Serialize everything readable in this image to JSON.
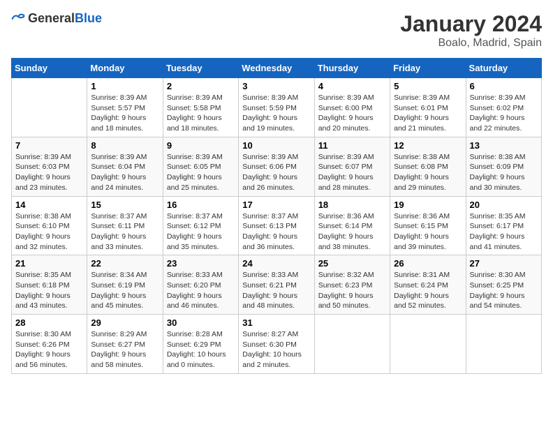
{
  "header": {
    "logo_general": "General",
    "logo_blue": "Blue",
    "month": "January 2024",
    "location": "Boalo, Madrid, Spain"
  },
  "weekdays": [
    "Sunday",
    "Monday",
    "Tuesday",
    "Wednesday",
    "Thursday",
    "Friday",
    "Saturday"
  ],
  "rows": [
    [
      {
        "day": "",
        "sunrise": "",
        "sunset": "",
        "daylight": ""
      },
      {
        "day": "1",
        "sunrise": "Sunrise: 8:39 AM",
        "sunset": "Sunset: 5:57 PM",
        "daylight": "Daylight: 9 hours and 18 minutes."
      },
      {
        "day": "2",
        "sunrise": "Sunrise: 8:39 AM",
        "sunset": "Sunset: 5:58 PM",
        "daylight": "Daylight: 9 hours and 18 minutes."
      },
      {
        "day": "3",
        "sunrise": "Sunrise: 8:39 AM",
        "sunset": "Sunset: 5:59 PM",
        "daylight": "Daylight: 9 hours and 19 minutes."
      },
      {
        "day": "4",
        "sunrise": "Sunrise: 8:39 AM",
        "sunset": "Sunset: 6:00 PM",
        "daylight": "Daylight: 9 hours and 20 minutes."
      },
      {
        "day": "5",
        "sunrise": "Sunrise: 8:39 AM",
        "sunset": "Sunset: 6:01 PM",
        "daylight": "Daylight: 9 hours and 21 minutes."
      },
      {
        "day": "6",
        "sunrise": "Sunrise: 8:39 AM",
        "sunset": "Sunset: 6:02 PM",
        "daylight": "Daylight: 9 hours and 22 minutes."
      }
    ],
    [
      {
        "day": "7",
        "sunrise": "Sunrise: 8:39 AM",
        "sunset": "Sunset: 6:03 PM",
        "daylight": "Daylight: 9 hours and 23 minutes."
      },
      {
        "day": "8",
        "sunrise": "Sunrise: 8:39 AM",
        "sunset": "Sunset: 6:04 PM",
        "daylight": "Daylight: 9 hours and 24 minutes."
      },
      {
        "day": "9",
        "sunrise": "Sunrise: 8:39 AM",
        "sunset": "Sunset: 6:05 PM",
        "daylight": "Daylight: 9 hours and 25 minutes."
      },
      {
        "day": "10",
        "sunrise": "Sunrise: 8:39 AM",
        "sunset": "Sunset: 6:06 PM",
        "daylight": "Daylight: 9 hours and 26 minutes."
      },
      {
        "day": "11",
        "sunrise": "Sunrise: 8:39 AM",
        "sunset": "Sunset: 6:07 PM",
        "daylight": "Daylight: 9 hours and 28 minutes."
      },
      {
        "day": "12",
        "sunrise": "Sunrise: 8:38 AM",
        "sunset": "Sunset: 6:08 PM",
        "daylight": "Daylight: 9 hours and 29 minutes."
      },
      {
        "day": "13",
        "sunrise": "Sunrise: 8:38 AM",
        "sunset": "Sunset: 6:09 PM",
        "daylight": "Daylight: 9 hours and 30 minutes."
      }
    ],
    [
      {
        "day": "14",
        "sunrise": "Sunrise: 8:38 AM",
        "sunset": "Sunset: 6:10 PM",
        "daylight": "Daylight: 9 hours and 32 minutes."
      },
      {
        "day": "15",
        "sunrise": "Sunrise: 8:37 AM",
        "sunset": "Sunset: 6:11 PM",
        "daylight": "Daylight: 9 hours and 33 minutes."
      },
      {
        "day": "16",
        "sunrise": "Sunrise: 8:37 AM",
        "sunset": "Sunset: 6:12 PM",
        "daylight": "Daylight: 9 hours and 35 minutes."
      },
      {
        "day": "17",
        "sunrise": "Sunrise: 8:37 AM",
        "sunset": "Sunset: 6:13 PM",
        "daylight": "Daylight: 9 hours and 36 minutes."
      },
      {
        "day": "18",
        "sunrise": "Sunrise: 8:36 AM",
        "sunset": "Sunset: 6:14 PM",
        "daylight": "Daylight: 9 hours and 38 minutes."
      },
      {
        "day": "19",
        "sunrise": "Sunrise: 8:36 AM",
        "sunset": "Sunset: 6:15 PM",
        "daylight": "Daylight: 9 hours and 39 minutes."
      },
      {
        "day": "20",
        "sunrise": "Sunrise: 8:35 AM",
        "sunset": "Sunset: 6:17 PM",
        "daylight": "Daylight: 9 hours and 41 minutes."
      }
    ],
    [
      {
        "day": "21",
        "sunrise": "Sunrise: 8:35 AM",
        "sunset": "Sunset: 6:18 PM",
        "daylight": "Daylight: 9 hours and 43 minutes."
      },
      {
        "day": "22",
        "sunrise": "Sunrise: 8:34 AM",
        "sunset": "Sunset: 6:19 PM",
        "daylight": "Daylight: 9 hours and 45 minutes."
      },
      {
        "day": "23",
        "sunrise": "Sunrise: 8:33 AM",
        "sunset": "Sunset: 6:20 PM",
        "daylight": "Daylight: 9 hours and 46 minutes."
      },
      {
        "day": "24",
        "sunrise": "Sunrise: 8:33 AM",
        "sunset": "Sunset: 6:21 PM",
        "daylight": "Daylight: 9 hours and 48 minutes."
      },
      {
        "day": "25",
        "sunrise": "Sunrise: 8:32 AM",
        "sunset": "Sunset: 6:23 PM",
        "daylight": "Daylight: 9 hours and 50 minutes."
      },
      {
        "day": "26",
        "sunrise": "Sunrise: 8:31 AM",
        "sunset": "Sunset: 6:24 PM",
        "daylight": "Daylight: 9 hours and 52 minutes."
      },
      {
        "day": "27",
        "sunrise": "Sunrise: 8:30 AM",
        "sunset": "Sunset: 6:25 PM",
        "daylight": "Daylight: 9 hours and 54 minutes."
      }
    ],
    [
      {
        "day": "28",
        "sunrise": "Sunrise: 8:30 AM",
        "sunset": "Sunset: 6:26 PM",
        "daylight": "Daylight: 9 hours and 56 minutes."
      },
      {
        "day": "29",
        "sunrise": "Sunrise: 8:29 AM",
        "sunset": "Sunset: 6:27 PM",
        "daylight": "Daylight: 9 hours and 58 minutes."
      },
      {
        "day": "30",
        "sunrise": "Sunrise: 8:28 AM",
        "sunset": "Sunset: 6:29 PM",
        "daylight": "Daylight: 10 hours and 0 minutes."
      },
      {
        "day": "31",
        "sunrise": "Sunrise: 8:27 AM",
        "sunset": "Sunset: 6:30 PM",
        "daylight": "Daylight: 10 hours and 2 minutes."
      },
      {
        "day": "",
        "sunrise": "",
        "sunset": "",
        "daylight": ""
      },
      {
        "day": "",
        "sunrise": "",
        "sunset": "",
        "daylight": ""
      },
      {
        "day": "",
        "sunrise": "",
        "sunset": "",
        "daylight": ""
      }
    ]
  ]
}
